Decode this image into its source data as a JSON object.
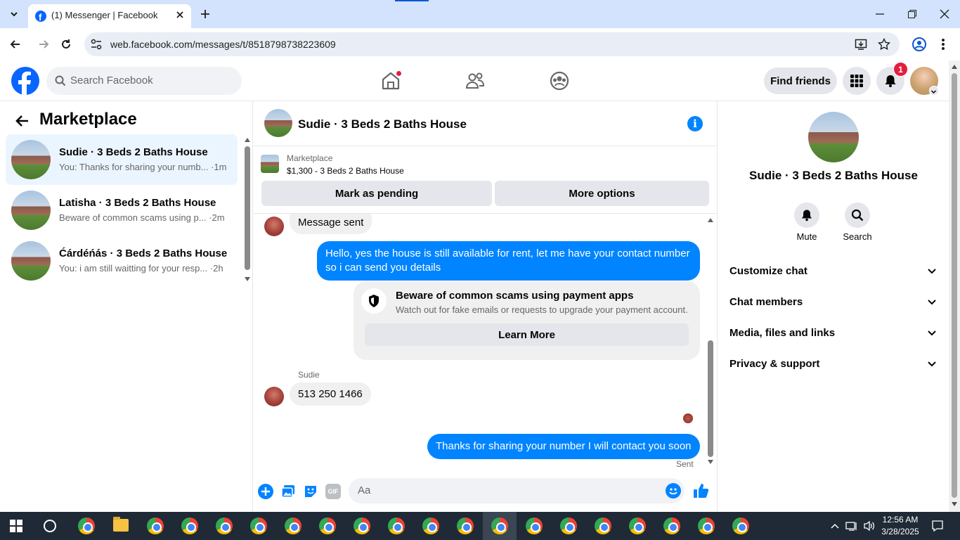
{
  "browser": {
    "tab_title": "(1) Messenger | Facebook",
    "url": "web.facebook.com/messages/t/8518798738223609"
  },
  "header": {
    "search_placeholder": "Search Facebook",
    "find_friends": "Find friends",
    "notification_count": "1"
  },
  "sidebar": {
    "title": "Marketplace",
    "conversations": [
      {
        "name": "Sudie · 3 Beds 2 Baths House",
        "snippet": "You: Thanks for sharing your numb... ·1m",
        "active": true
      },
      {
        "name": "Latisha · 3 Beds 2 Baths House",
        "snippet": "Beware of common scams using p... ·2m",
        "active": false
      },
      {
        "name": "Ćárdéńás · 3 Beds 2 Baths House",
        "snippet": "You: i am still waitting for your resp... ·2h",
        "active": false
      }
    ]
  },
  "chat": {
    "title": "Sudie · 3 Beds 2 Baths House",
    "listing_label": "Marketplace",
    "listing_detail": "$1,300 - 3 Beds 2 Baths House",
    "mark_pending": "Mark as pending",
    "more_options": "More options",
    "messages": {
      "message_sent": "Message sent",
      "out1": "Hello, yes the house is still available for rent, let me have your contact number so i can send you  details",
      "scam_title": "Beware of common scams using payment apps",
      "scam_body": "Watch out for fake emails or requests to upgrade your payment account.",
      "learn_more": "Learn More",
      "sender_name": "Sudie",
      "in1": "513 250 1466",
      "out2": "Thanks for sharing your number I will contact you soon",
      "status": "Sent"
    },
    "composer_placeholder": "Aa",
    "gif_label": "GIF"
  },
  "details": {
    "name": "Sudie · 3 Beds 2 Baths House",
    "mute": "Mute",
    "search": "Search",
    "sections": [
      "Customize chat",
      "Chat members",
      "Media, files and links",
      "Privacy & support"
    ]
  },
  "taskbar": {
    "time": "12:56 AM",
    "date": "3/28/2025"
  },
  "colors": {
    "fb_blue": "#0866ff",
    "messenger_blue": "#0084ff",
    "notif_red": "#e41e3f"
  }
}
